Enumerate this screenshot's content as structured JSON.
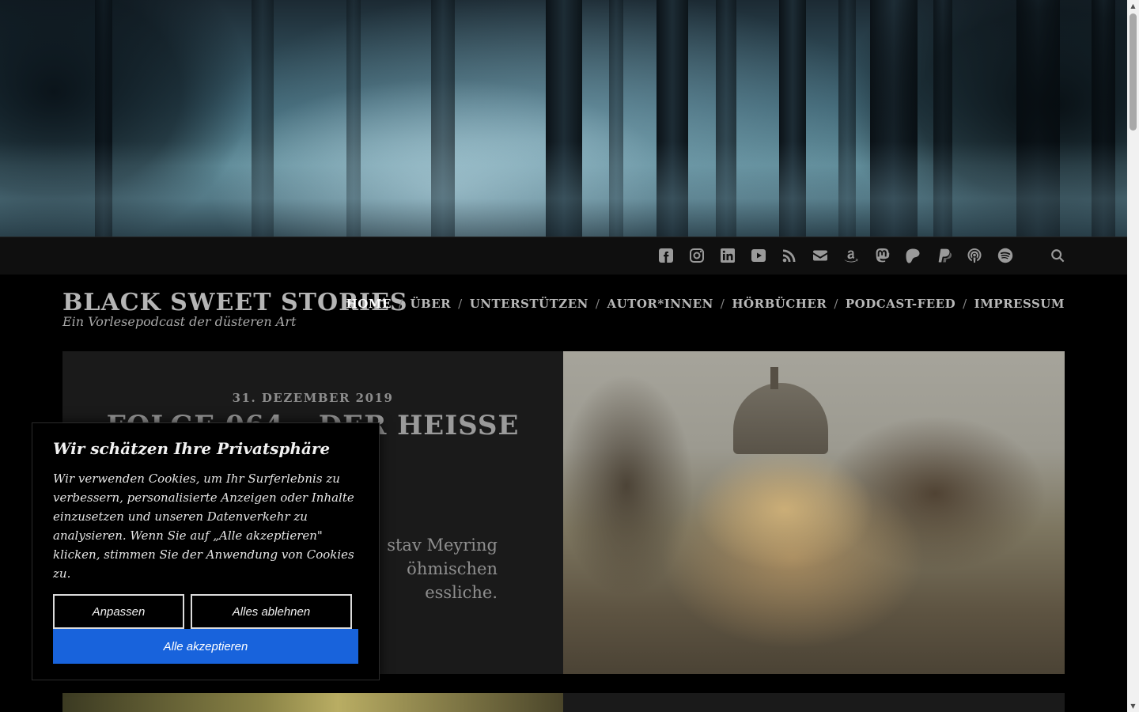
{
  "site": {
    "title": "BLACK SWEET STORIES",
    "tagline": "Ein Vorlesepodcast der düsteren Art"
  },
  "nav": {
    "items": [
      {
        "label": "HOME",
        "active": true
      },
      {
        "label": "ÜBER",
        "active": false
      },
      {
        "label": "UNTERSTÜTZEN",
        "active": false
      },
      {
        "label": "AUTOR*INNEN",
        "active": false
      },
      {
        "label": "HÖRBÜCHER",
        "active": false
      },
      {
        "label": "PODCAST-FEED",
        "active": false
      },
      {
        "label": "IMPRESSUM",
        "active": false
      }
    ],
    "separator": "/"
  },
  "social": {
    "icons": [
      "facebook-icon",
      "instagram-icon",
      "linkedin-icon",
      "youtube-icon",
      "rss-icon",
      "email-icon",
      "amazon-icon",
      "mastodon-icon",
      "patreon-icon",
      "paypal-icon",
      "podcast-icon",
      "spotify-icon"
    ],
    "search_icon": "search-icon"
  },
  "featured_post": {
    "date": "31. DEZEMBER 2019",
    "title": "FOLGE 064 – DER HEISSE",
    "excerpt": "stav Meyring\nöhmischen\nessliche."
  },
  "cookie_banner": {
    "title": "Wir schätzen Ihre Privatsphäre",
    "body": "Wir verwenden Cookies, um Ihr Surferlebnis zu verbessern, personalisierte Anzeigen oder Inhalte einzusetzen und unseren Datenverkehr zu analysieren. Wenn Sie auf „Alle akzeptieren\" klicken, stimmen Sie der Anwendung von Cookies zu.",
    "customize_label": "Anpassen",
    "reject_label": "Alles ablehnen",
    "accept_label": "Alle akzeptieren",
    "accept_color": "#1863dc"
  }
}
